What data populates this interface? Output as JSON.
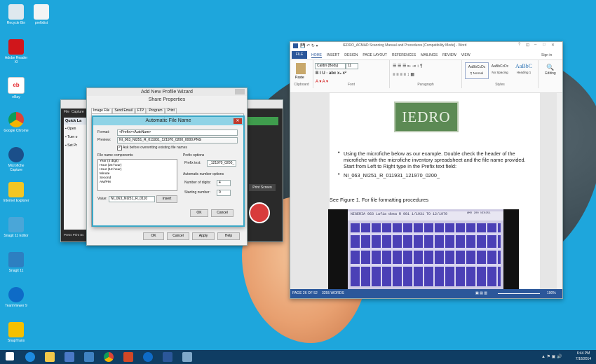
{
  "desktop": {
    "icons": [
      {
        "label": "Recycle Bin"
      },
      {
        "label": "prefixlist"
      },
      {
        "label": "Adobe Reader XI"
      },
      {
        "label": "eBay"
      },
      {
        "label": "Google Chrome"
      },
      {
        "label": "Microfiche Capture"
      },
      {
        "label": "Internet Explorer"
      },
      {
        "label": "Snagit 11 Editor"
      },
      {
        "label": "Snagit 11"
      },
      {
        "label": "TeamViewer 9"
      },
      {
        "label": "SnapTrans"
      }
    ]
  },
  "word": {
    "title": "IEDRO_ACMAD Scanning Manual and Procedures [Compatibility Mode] - Word",
    "window_controls": {
      "help": "?",
      "ribbon": "⊡",
      "min": "–",
      "max": "□",
      "close": "✕"
    },
    "signin": "Sign in",
    "tabs": [
      "FILE",
      "HOME",
      "INSERT",
      "DESIGN",
      "PAGE LAYOUT",
      "REFERENCES",
      "MAILINGS",
      "REVIEW",
      "VIEW"
    ],
    "font_name": "Calibri (Body)",
    "font_size": "11",
    "paste_label": "Paste",
    "editing_label": "Editing",
    "groups": {
      "clipboard": "Clipboard",
      "font": "Font",
      "paragraph": "Paragraph",
      "styles": "Styles"
    },
    "styles": [
      {
        "preview": "AaBbCcDc",
        "name": "¶ Normal"
      },
      {
        "preview": "AaBbCcDc",
        "name": "No Spacing"
      },
      {
        "preview": "AaBbC",
        "name": "Heading 1"
      }
    ],
    "logo_text": "IEDRO",
    "bullet1": "Using the microfiche below as our example.  Double check the header of the microfiche with the microfiche inventory spreadsheet and the file name provided.  Start from Left to Right type in the Prefix text field:",
    "bullet2": "NI_063_NI251_R_011931_121970_0200_",
    "figure_caption": "See Figure 1. For file formatting procedures",
    "fiche_header1": "NIGERIA   063 Lafia  dosa  R 001   1/1931 TO 12/1970",
    "fiche_header2": "WMO 200 NI0251",
    "status": {
      "page": "PAGE 26 OF 52",
      "words": "3255 WORDS",
      "zoom": "100%"
    }
  },
  "bg_app": {
    "menu": [
      "File",
      "Capture"
    ],
    "quick_launch": "Quick La",
    "items": [
      "Open",
      "Turn o",
      "Set Pr"
    ],
    "status": "Press Print Sc",
    "print_screen": "Print Screen"
  },
  "wizard": {
    "title": "Add New Profile Wizard",
    "share_title": "Share Properties",
    "tabs": [
      "Image File",
      "Send Email",
      "FTP",
      "Program",
      "Print"
    ],
    "buttons": {
      "ok": "OK",
      "cancel": "Cancel",
      "apply": "Apply",
      "help": "Help"
    }
  },
  "afn": {
    "title": "Automatic File Name",
    "format_label": "Format:",
    "format_value": "<Prefix><AutoNum>",
    "preview_label": "Preview:",
    "preview_value": "NI_063_NI251_R_011931_121970_0200_0000.PNG",
    "ask_label": "Ask before overwriting existing file names",
    "components_label": "File name components",
    "components": [
      "Year (4 digit)",
      "Hour (24-hour)",
      "Hour (12-hour)",
      "Minute",
      "Second",
      "AM/PM"
    ],
    "value_label": "Value:",
    "value_value": "NI_063_NI251_R_0110",
    "insert": "Insert",
    "prefix_group": "Prefix options",
    "prefix_label": "Prefix text:",
    "prefix_value": "_121970_0200_",
    "auto_group": "Automatic number options",
    "digits_label": "Number of digits:",
    "digits_value": "4",
    "start_label": "Starting number:",
    "start_value": "0",
    "ok": "OK",
    "cancel": "Cancel"
  },
  "taskbar": {
    "time": "6:44 PM",
    "date": "7/18/2014"
  }
}
